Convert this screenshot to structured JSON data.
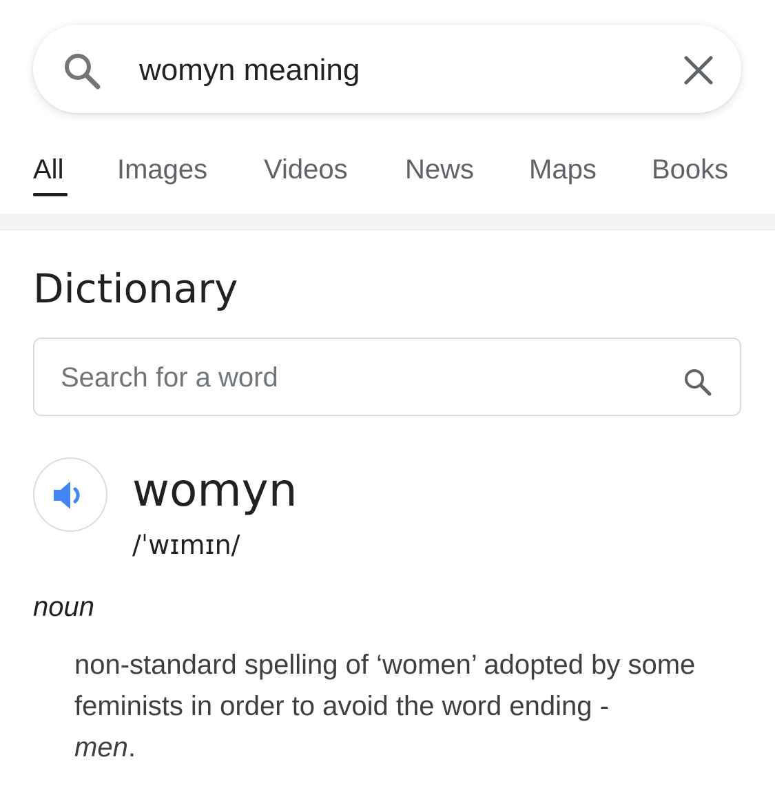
{
  "search": {
    "query": "womyn meaning"
  },
  "tabs": [
    {
      "label": "All",
      "active": true
    },
    {
      "label": "Images",
      "active": false
    },
    {
      "label": "Videos",
      "active": false
    },
    {
      "label": "News",
      "active": false
    },
    {
      "label": "Maps",
      "active": false
    },
    {
      "label": "Books",
      "active": false
    }
  ],
  "dictionary": {
    "title": "Dictionary",
    "search_placeholder": "Search for a word",
    "headword": "womyn",
    "pronunciation": "/ˈwɪmɪn/",
    "part_of_speech": "noun",
    "definition_main": "non-standard spelling of ‘women’ adopted by some feminists in order to avoid the word ending -",
    "definition_italic": "men",
    "definition_end": "."
  },
  "colors": {
    "speaker_accent": "#4285f4",
    "text_primary": "#202124",
    "text_secondary": "#5f6368"
  }
}
